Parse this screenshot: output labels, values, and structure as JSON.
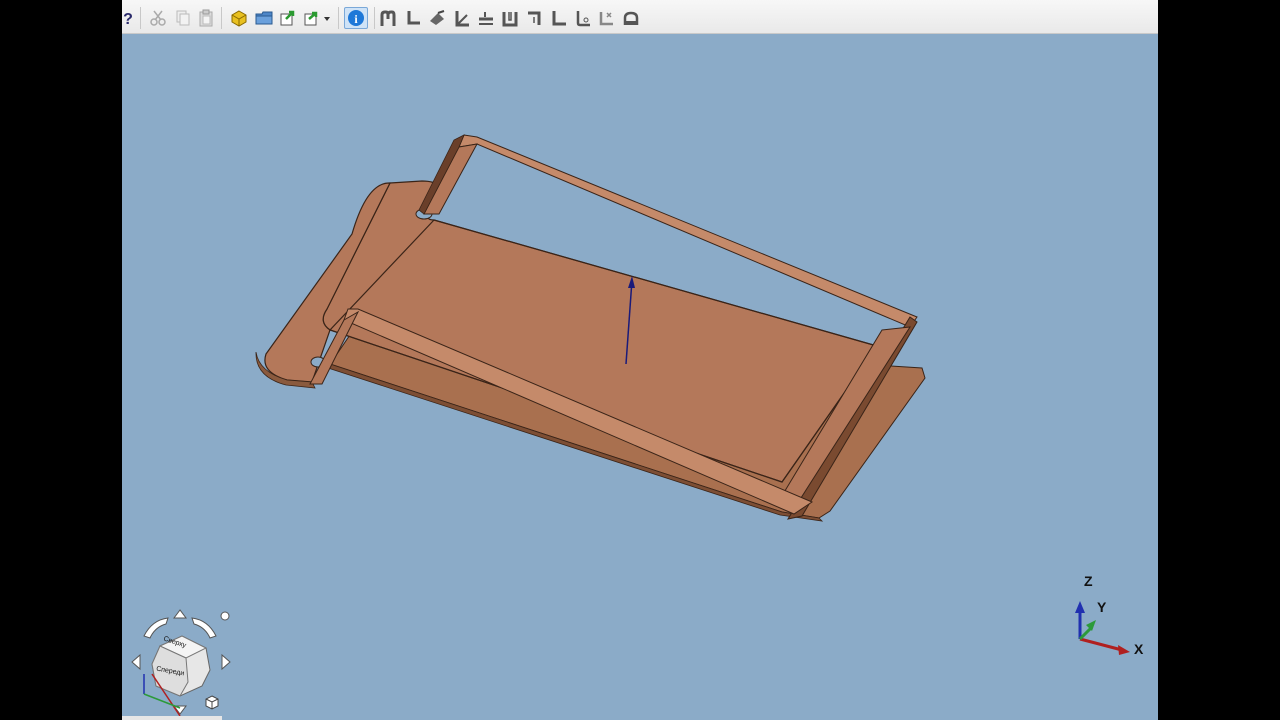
{
  "app": {
    "background_color": "#8babc8",
    "part_color": "#b4785a",
    "part_edge_color": "#3a2418"
  },
  "toolbar": {
    "buttons": [
      {
        "name": "help-icon",
        "enabled": true
      },
      {
        "name": "cut-icon",
        "enabled": false
      },
      {
        "name": "copy-icon",
        "enabled": false
      },
      {
        "name": "paste-icon",
        "enabled": false
      },
      {
        "name": "open-part-icon",
        "enabled": true
      },
      {
        "name": "open-folder-icon",
        "enabled": true
      },
      {
        "name": "export-icon",
        "enabled": true
      },
      {
        "name": "send-to-icon",
        "enabled": true
      },
      {
        "name": "info-icon",
        "enabled": true,
        "active": true
      },
      {
        "name": "base-flange-icon",
        "enabled": true
      },
      {
        "name": "edge-flange-icon",
        "enabled": true
      },
      {
        "name": "unfold-icon",
        "enabled": true
      },
      {
        "name": "miter-flange-icon",
        "enabled": true
      },
      {
        "name": "jog-icon",
        "enabled": true
      },
      {
        "name": "hem-icon",
        "enabled": true
      },
      {
        "name": "closed-corner-icon",
        "enabled": true
      },
      {
        "name": "sketched-bend-icon",
        "enabled": true
      },
      {
        "name": "rip-icon",
        "enabled": true
      },
      {
        "name": "convert-to-sheet-metal-icon",
        "enabled": true
      },
      {
        "name": "flatten-icon",
        "enabled": true
      }
    ]
  },
  "axes": {
    "x_label": "X",
    "y_label": "Y",
    "z_label": "Z",
    "x_color": "#b02020",
    "y_color": "#2c9a3a",
    "z_color": "#2030b0"
  },
  "navcube": {
    "top_label": "Сверху",
    "front_label": "Спереди"
  }
}
